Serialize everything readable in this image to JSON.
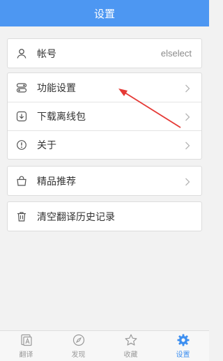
{
  "header": {
    "title": "设置"
  },
  "groups": {
    "account": {
      "label": "帐号",
      "value": "elselect",
      "icon": "user-icon"
    },
    "feature_settings": {
      "label": "功能设置",
      "icon": "toggle-icon"
    },
    "download_offline": {
      "label": "下载离线包",
      "icon": "download-icon"
    },
    "about": {
      "label": "关于",
      "icon": "info-icon"
    },
    "recommend": {
      "label": "精品推荐",
      "icon": "bag-icon"
    },
    "clear_history": {
      "label": "清空翻译历史记录",
      "icon": "trash-icon"
    }
  },
  "annotation": {
    "color": "#e53935"
  },
  "tabs": [
    {
      "label": "翻译",
      "icon": "translate-icon",
      "active": false
    },
    {
      "label": "发现",
      "icon": "discover-icon",
      "active": false
    },
    {
      "label": "收藏",
      "icon": "star-icon",
      "active": false
    },
    {
      "label": "设置",
      "icon": "gear-icon",
      "active": true
    }
  ],
  "colors": {
    "accent": "#4d97f2",
    "tab_active": "#3d8ff0"
  }
}
